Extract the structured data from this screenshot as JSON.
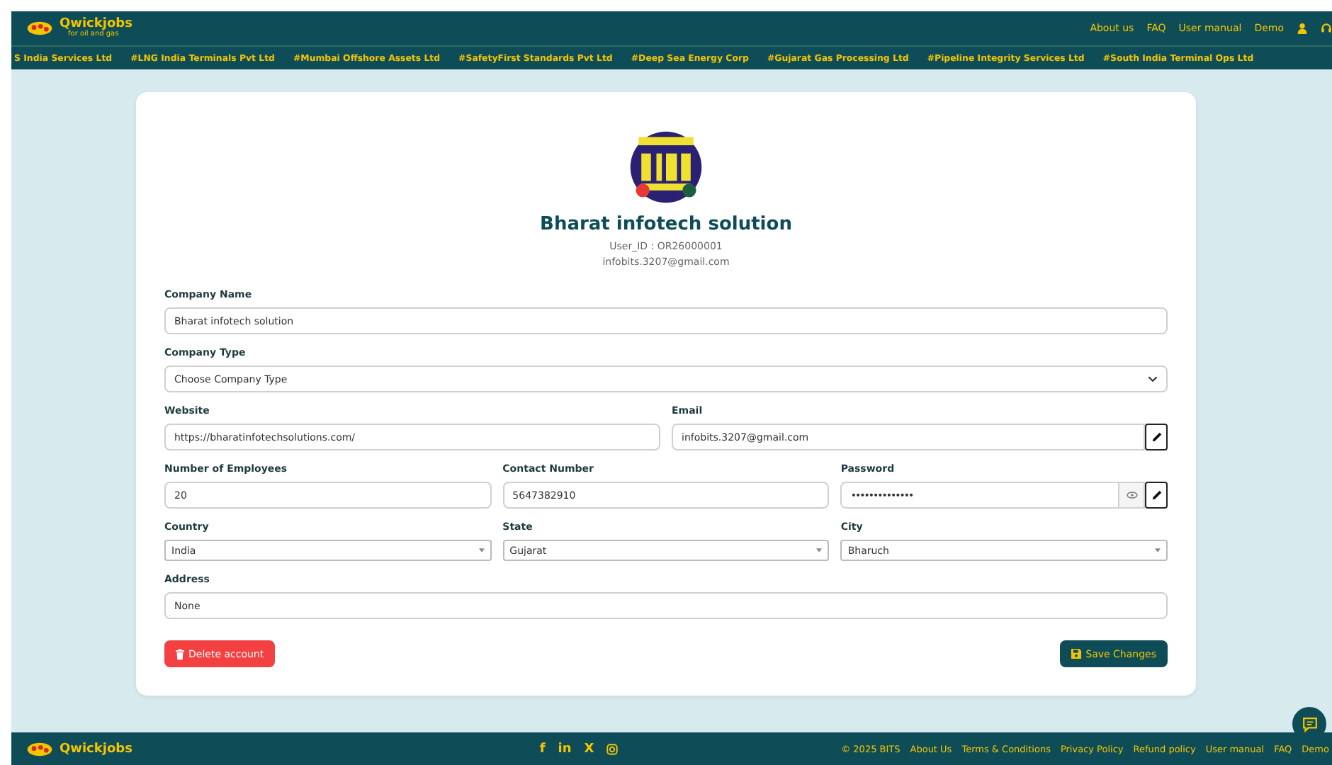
{
  "header": {
    "brand": "Qwickjobs",
    "tagline": "for oil and gas",
    "nav": [
      "About us",
      "FAQ",
      "User manual",
      "Demo"
    ]
  },
  "ticker": [
    "S India Services Ltd",
    "#LNG India Terminals Pvt Ltd",
    "#Mumbai Offshore Assets Ltd",
    "#SafetyFirst Standards Pvt Ltd",
    "#Deep Sea Energy Corp",
    "#Gujarat Gas Processing Ltd",
    "#Pipeline Integrity Services Ltd",
    "#South India Terminal Ops Ltd"
  ],
  "profile": {
    "name": "Bharat infotech solution",
    "user_id": "User_ID : OR26000001",
    "email": "infobits.3207@gmail.com"
  },
  "form": {
    "rows": [
      [
        {
          "label": "Company Name",
          "kind": "text",
          "value": "Bharat infotech solution"
        }
      ],
      [
        {
          "label": "Company Type",
          "kind": "dropdown",
          "value": "Choose Company Type"
        }
      ],
      [
        {
          "label": "Website",
          "kind": "text",
          "value": "https://bharatinfotechsolutions.com/"
        },
        {
          "label": "Email",
          "kind": "editable",
          "value": "infobits.3207@gmail.com"
        }
      ],
      [
        {
          "label": "Number of Employees",
          "kind": "text",
          "value": "20"
        },
        {
          "label": "Contact Number",
          "kind": "text",
          "value": "5647382910"
        },
        {
          "label": "Password",
          "kind": "password",
          "value": "••••••••••••••"
        }
      ],
      [
        {
          "label": "Country",
          "kind": "combo",
          "value": "India"
        },
        {
          "label": "State",
          "kind": "combo",
          "value": "Gujarat"
        },
        {
          "label": "City",
          "kind": "combo",
          "value": "Bharuch"
        }
      ],
      [
        {
          "label": "Address",
          "kind": "text",
          "value": "None"
        }
      ]
    ]
  },
  "actions": {
    "delete": "Delete account",
    "save": "Save Changes"
  },
  "footer": {
    "brand": "Qwickjobs",
    "social": [
      "f",
      "in",
      "X"
    ],
    "links": [
      "© 2025 BITS",
      "About Us",
      "Terms & Conditions",
      "Privacy Policy",
      "Refund policy",
      "User manual",
      "FAQ",
      "Demo"
    ]
  }
}
